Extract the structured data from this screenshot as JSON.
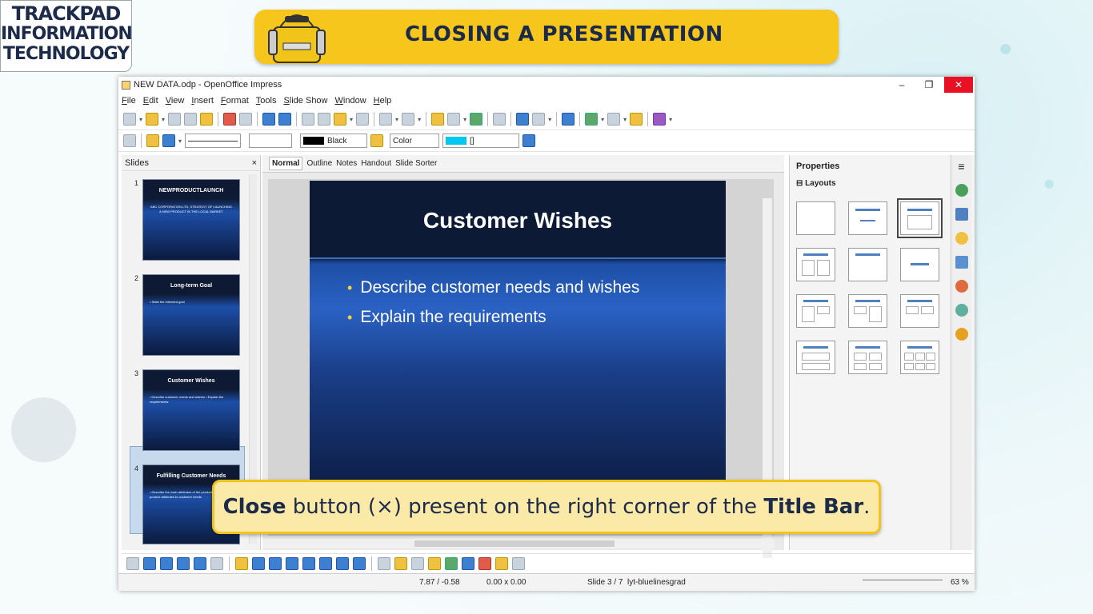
{
  "logo": {
    "line1": "TRACKPAD",
    "line2": "INFORMATION",
    "line3": "TECHNOLOGY"
  },
  "banner": {
    "title": "CLOSING A PRESENTATION"
  },
  "window": {
    "title": "NEW DATA.odp - OpenOffice Impress",
    "minimize": "–",
    "maximize": "❐",
    "close": "✕"
  },
  "menu": [
    "File",
    "Edit",
    "View",
    "Insert",
    "Format",
    "Tools",
    "Slide Show",
    "Window",
    "Help"
  ],
  "format_toolbar": {
    "line_color": "Black",
    "fill_type": "Color",
    "fill_color": "[]"
  },
  "slides_pane": {
    "title": "Slides",
    "close": "×",
    "slides": [
      {
        "num": "1",
        "title": "NEWPRODUCTLAUNCH",
        "body": "ABC CORPORATION LTD. STRATEGY OF LAUNCHING A NEW PRODUCT IN THE LOCAL MARKET"
      },
      {
        "num": "2",
        "title": "Long-term Goal",
        "body": "• State the intended goal"
      },
      {
        "num": "3",
        "title": "Customer Wishes",
        "body": "• Describe customer needs and wishes • Explain the requirements"
      },
      {
        "num": "4",
        "title": "Fulfilling Customer Needs",
        "body": "• Describe the main attributes of the product • Link the product attributes to customer needs"
      }
    ]
  },
  "view_tabs": [
    "Normal",
    "Outline",
    "Notes",
    "Handout",
    "Slide Sorter"
  ],
  "slide": {
    "title": "Customer Wishes",
    "bullets": [
      "Describe customer needs and wishes",
      "Explain the requirements"
    ]
  },
  "properties": {
    "title": "Properties",
    "close": "×",
    "section": "Layouts"
  },
  "status": {
    "position": "7.87 / -0.58",
    "size": "0.00 x 0.00",
    "slide": "Slide 3 / 7",
    "layout": "lyt-bluelinesgrad",
    "zoom": "63 %"
  },
  "caption": {
    "bold1": "Close",
    "text1": " button (×) present on the right corner of the ",
    "bold2": "Title Bar",
    "text2": "."
  }
}
